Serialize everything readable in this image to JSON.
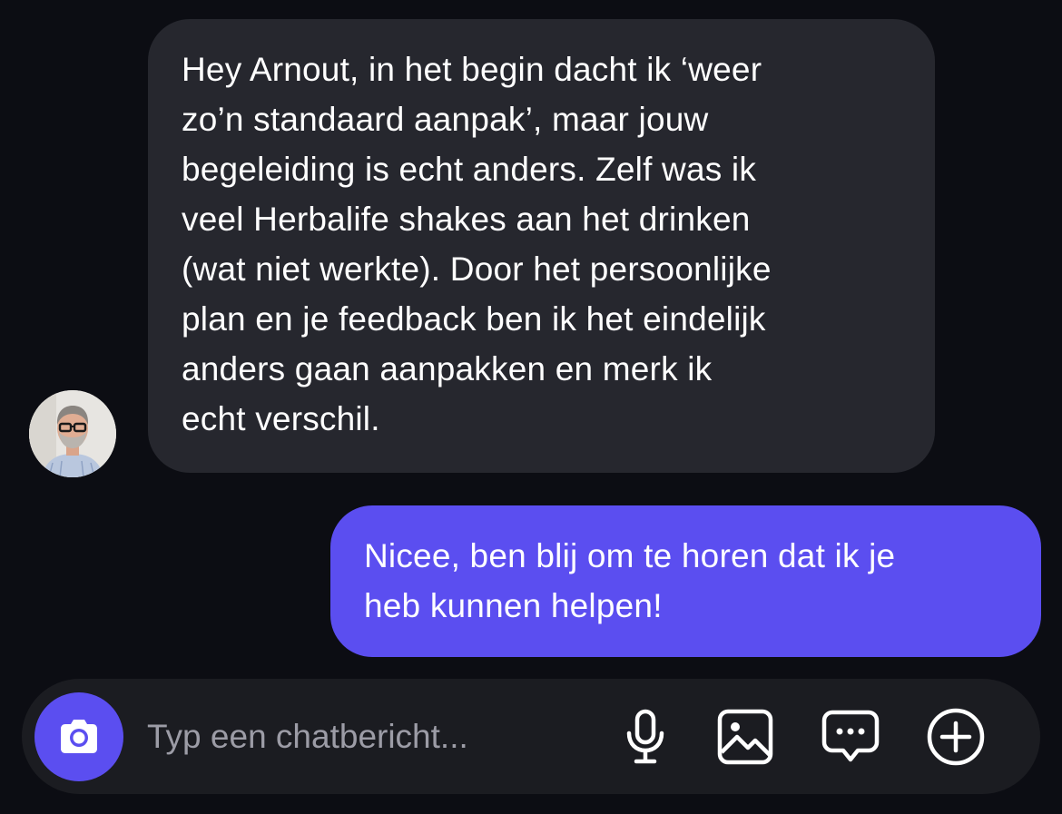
{
  "incoming": {
    "lines": [
      "Hey Arnout, in het begin dacht ik ‘weer",
      "zo’n standaard aanpak’, maar jouw",
      "begeleiding is echt anders. Zelf was ik",
      "veel Herbalife shakes aan het drinken",
      "(wat niet werkte). Door het persoonlijke",
      "plan en je feedback ben ik het eindelijk",
      "anders gaan aanpakken en merk ik",
      "echt verschil."
    ]
  },
  "outgoing": {
    "lines": [
      "Nicee, ben blij om te horen dat ik je",
      "heb kunnen helpen!"
    ]
  },
  "composer": {
    "placeholder": "Typ een chatbericht..."
  },
  "icons": {
    "avatar": "person-photo-avatar",
    "camera": "camera-icon",
    "mic": "microphone-icon",
    "gallery": "image-icon",
    "chat": "chat-bubble-icon",
    "plus": "plus-circle-icon"
  },
  "colors": {
    "background": "#0c0d13",
    "incoming_bubble": "#26272e",
    "outgoing_bubble": "#5b4ef0",
    "composer": "#1b1c21",
    "accent": "#5b4ef0"
  }
}
